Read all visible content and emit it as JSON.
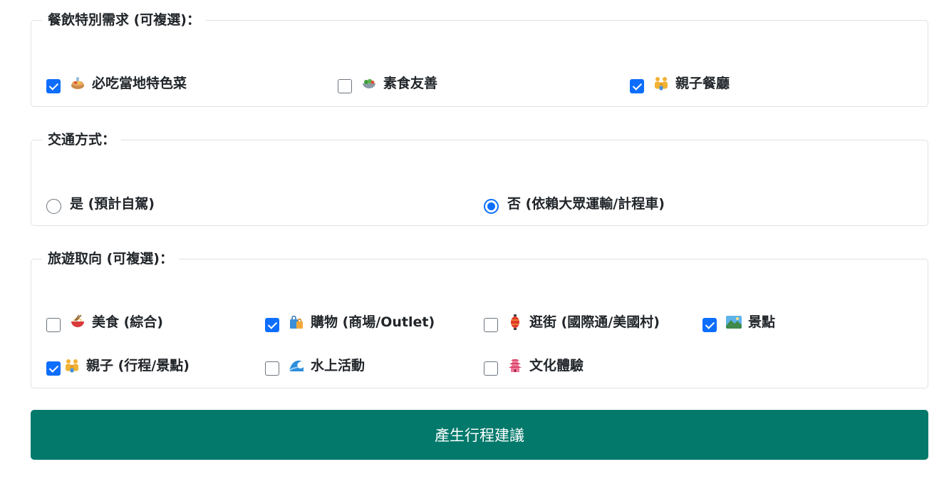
{
  "diet": {
    "legend": "餐飲特別需求 (可複選)：",
    "options": [
      {
        "label": "必吃當地特色菜",
        "checked": true,
        "icon": "local-dish-icon"
      },
      {
        "label": "素食友善",
        "checked": false,
        "icon": "salad-bowl-icon"
      },
      {
        "label": "親子餐廳",
        "checked": true,
        "icon": "family-icon"
      }
    ]
  },
  "transport": {
    "legend": "交通方式：",
    "options": [
      {
        "label": "是 (預計自駕)",
        "selected": false
      },
      {
        "label": "否 (依賴大眾運輸/計程車)",
        "selected": true
      }
    ]
  },
  "interests": {
    "legend": "旅遊取向 (可複選)：",
    "options": [
      {
        "label": "美食 (綜合)",
        "checked": false,
        "icon": "noodle-bowl-icon"
      },
      {
        "label": "購物 (商場/Outlet)",
        "checked": true,
        "icon": "shopping-bags-icon"
      },
      {
        "label": "逛街 (國際通/美國村)",
        "checked": false,
        "icon": "lantern-icon"
      },
      {
        "label": "景點",
        "checked": true,
        "icon": "landscape-icon"
      },
      {
        "label": "親子 (行程/景點)",
        "checked": true,
        "icon": "family-icon"
      },
      {
        "label": "水上活動",
        "checked": false,
        "icon": "wave-icon"
      },
      {
        "label": "文化體驗",
        "checked": false,
        "icon": "pagoda-icon"
      }
    ]
  },
  "colors": {
    "accent": "#0d6efd",
    "primary_button": "#02796b"
  },
  "submit": {
    "label": "產生行程建議"
  }
}
